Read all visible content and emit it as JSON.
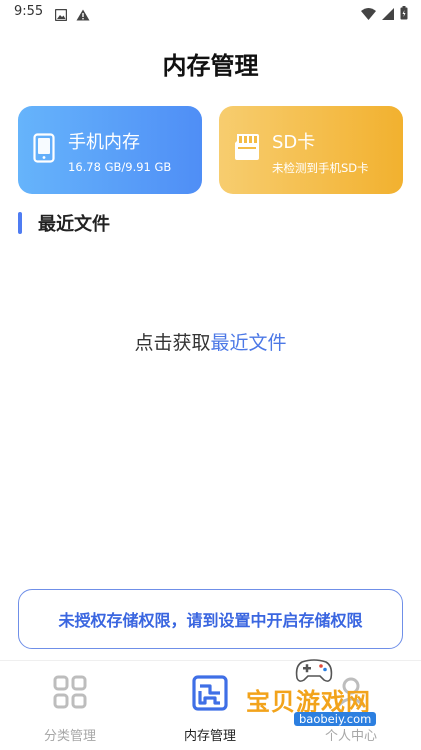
{
  "status_bar": {
    "time": "9:55",
    "left_icons": [
      "photo-icon",
      "warning-icon"
    ],
    "right_icons": [
      "wifi-icon",
      "signal-icon",
      "battery-icon"
    ]
  },
  "header": {
    "title": "内存管理"
  },
  "storage_cards": {
    "phone": {
      "icon": "phone-icon",
      "title": "手机内存",
      "subtitle": "16.78 GB/9.91 GB"
    },
    "sd": {
      "icon": "sd-card-icon",
      "title": "SD卡",
      "subtitle": "未检测到手机SD卡"
    }
  },
  "recent": {
    "title": "最近文件",
    "prompt_prefix": "点击获取",
    "prompt_link": "最近文件"
  },
  "permission_banner": {
    "text": "未授权存储权限，请到设置中开启存储权限"
  },
  "tabs": [
    {
      "label": "分类管理",
      "icon": "grid-icon"
    },
    {
      "label": "内存管理",
      "icon": "storage-icon"
    },
    {
      "label": "个人中心",
      "icon": "profile-icon"
    }
  ],
  "watermark": {
    "text": "宝贝游戏网",
    "url": "baobeiy.com"
  },
  "colors": {
    "accent": "#4f7cf2",
    "phone_card": "#5d9ef8",
    "sd_card": "#f4bc45",
    "banner_text": "#3a66e0"
  }
}
